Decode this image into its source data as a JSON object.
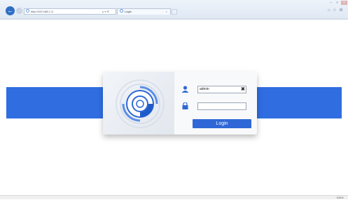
{
  "browser": {
    "address_url": "http://192.168.1.1/",
    "address_tools": "ρ ▾ ☰",
    "tab_title": "Login",
    "tab_close": "×",
    "back_glyph": "←",
    "forward_glyph": "→",
    "window_min": "–",
    "window_max": "□",
    "window_close": "×",
    "right_tools": "⌂ ☆ ⚙",
    "zoom": "· 100%"
  },
  "login": {
    "username_value": "admin",
    "password_value": "",
    "clear_glyph": "✖",
    "login_label": "Login"
  },
  "colors": {
    "band": "#2f6de0",
    "accent": "#2f68d6"
  },
  "icons": [
    "back-icon",
    "forward-icon",
    "ie-icon",
    "user-icon",
    "lock-icon",
    "clear-icon",
    "camera-logo-icon"
  ]
}
